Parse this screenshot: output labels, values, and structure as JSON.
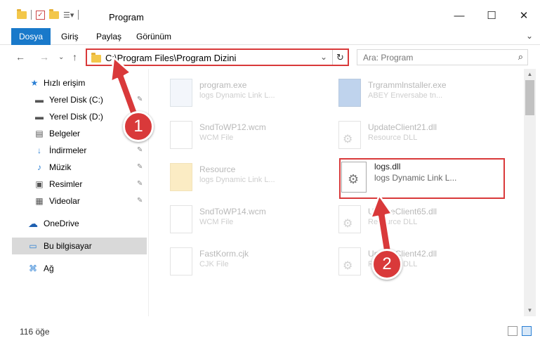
{
  "window": {
    "title": "Program",
    "minimize": "—",
    "maximize": "☐",
    "close": "✕"
  },
  "ribbon": {
    "tabs": [
      "Dosya",
      "Giriş",
      "Paylaş",
      "Görünüm"
    ],
    "expand": "⌄"
  },
  "address": {
    "path": "C:\\Program Files\\Program Dizini",
    "back": "←",
    "forward": "→",
    "recent": "⌄",
    "up": "↑",
    "dropdown": "⌄",
    "refresh": "↻"
  },
  "search": {
    "placeholder": "Ara: Program",
    "icon": "⌕"
  },
  "sidebar": {
    "items": [
      {
        "label": "Hızlı erişim",
        "icon": "star-icon",
        "glyph": "★",
        "pinned": false
      },
      {
        "label": "Yerel Disk (C:)",
        "icon": "drive-icon",
        "glyph": "▬",
        "pinned": true
      },
      {
        "label": "Yerel Disk (D:)",
        "icon": "drive-icon",
        "glyph": "▬",
        "pinned": true
      },
      {
        "label": "Belgeler",
        "icon": "documents-icon",
        "glyph": "▤",
        "pinned": true
      },
      {
        "label": "İndirmeler",
        "icon": "download-icon",
        "glyph": "↓",
        "pinned": true
      },
      {
        "label": "Müzik",
        "icon": "music-icon",
        "glyph": "♪",
        "pinned": true
      },
      {
        "label": "Resimler",
        "icon": "pictures-icon",
        "glyph": "▣",
        "pinned": true
      },
      {
        "label": "Videolar",
        "icon": "video-icon",
        "glyph": "▦",
        "pinned": true
      },
      {
        "label": "OneDrive",
        "icon": "cloud-icon",
        "glyph": "☁",
        "pinned": false
      },
      {
        "label": "Bu bilgisayar",
        "icon": "computer-icon",
        "glyph": "▭",
        "pinned": false
      },
      {
        "label": "Ağ",
        "icon": "network-icon",
        "glyph": "⌘",
        "pinned": false
      }
    ],
    "pin_glyph": "📌"
  },
  "files": [
    {
      "name": "program.exe",
      "desc": "logs Dynamic Link L..."
    },
    {
      "name": "Trgrammlnstaller.exe",
      "desc": "ABEY Enversabe tn..."
    },
    {
      "name": "SndToWP12.wcm",
      "desc": "WCM File"
    },
    {
      "name": "UpdateClient21.dll",
      "desc": "Resource DLL"
    },
    {
      "name": "Resource",
      "desc": "logs Dynamic Link L..."
    },
    {
      "name": "logs.dll",
      "desc": "logs Dynamic Link L..."
    },
    {
      "name": "SndToWP14.wcm",
      "desc": "WCM File"
    },
    {
      "name": "UpdateClient65.dll",
      "desc": "Resource DLL"
    },
    {
      "name": "FastKorm.cjk",
      "desc": "CJK File"
    },
    {
      "name": "UpdateClient42.dll",
      "desc": "Resource DLL"
    }
  ],
  "status": {
    "count": "116 öğe"
  },
  "annotations": {
    "badge1": "1",
    "badge2": "2",
    "color": "#d9393a"
  }
}
